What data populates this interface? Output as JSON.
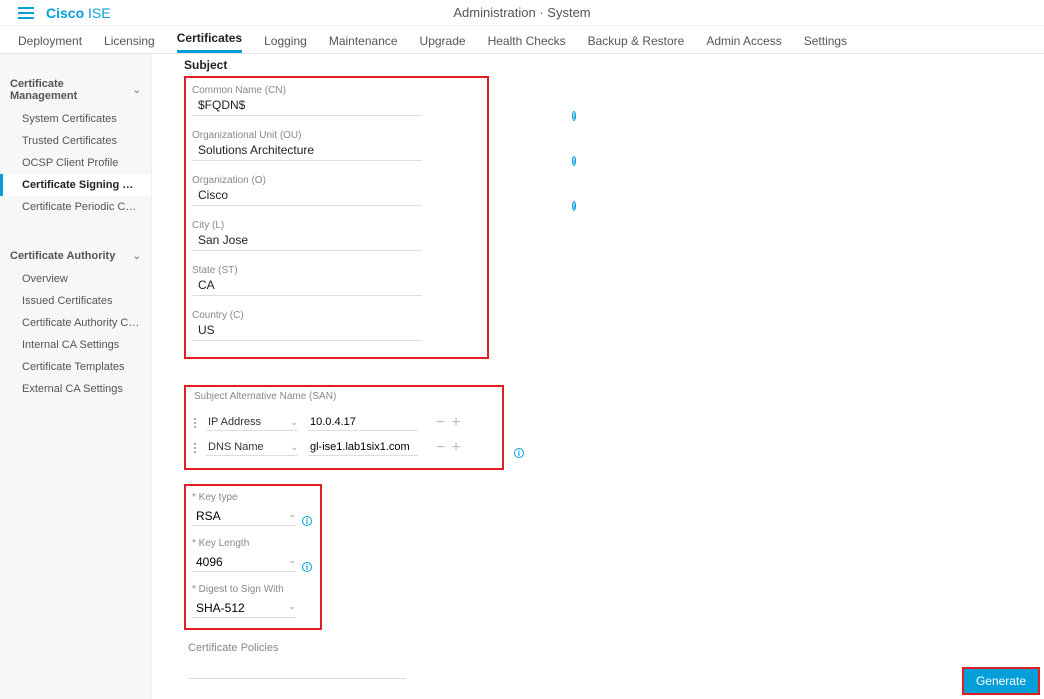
{
  "brand": {
    "cisco": "Cisco",
    "ise": "ISE"
  },
  "breadcrumb": "Administration · System",
  "tabs": [
    "Deployment",
    "Licensing",
    "Certificates",
    "Logging",
    "Maintenance",
    "Upgrade",
    "Health Checks",
    "Backup & Restore",
    "Admin Access",
    "Settings"
  ],
  "active_tab": "Certificates",
  "sidebar": {
    "sections": [
      {
        "title": "Certificate Management",
        "items": [
          "System Certificates",
          "Trusted Certificates",
          "OCSP Client Profile",
          "Certificate Signing Requests",
          "Certificate Periodic Check Se..."
        ],
        "selected": "Certificate Signing Requests"
      },
      {
        "title": "Certificate Authority",
        "items": [
          "Overview",
          "Issued Certificates",
          "Certificate Authority Certificat...",
          "Internal CA Settings",
          "Certificate Templates",
          "External CA Settings"
        ],
        "selected": null
      }
    ]
  },
  "section_title": "Subject",
  "subject": {
    "cn": {
      "label": "Common Name (CN)",
      "value": "$FQDN$"
    },
    "ou": {
      "label": "Organizational Unit (OU)",
      "value": "Solutions Architecture"
    },
    "o": {
      "label": "Organization (O)",
      "value": "Cisco"
    },
    "l": {
      "label": "City (L)",
      "value": "San Jose"
    },
    "st": {
      "label": "State (ST)",
      "value": "CA"
    },
    "c": {
      "label": "Country (C)",
      "value": "US"
    }
  },
  "san": {
    "title": "Subject Alternative Name (SAN)",
    "rows": [
      {
        "type": "IP Address",
        "value": "10.0.4.17"
      },
      {
        "type": "DNS Name",
        "value": "gl-ise1.lab1six1.com"
      }
    ]
  },
  "key": {
    "type_label": "Key type",
    "type_value": "RSA",
    "length_label": "Key Length",
    "length_value": "4096",
    "digest_label": "Digest to Sign With",
    "digest_value": "SHA-512"
  },
  "cert_policies_label": "Certificate Policies",
  "generate_label": "Generate"
}
